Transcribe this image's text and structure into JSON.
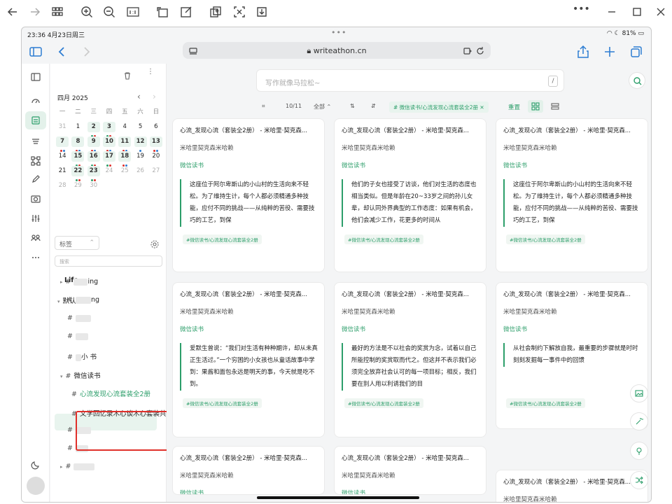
{
  "status": {
    "time": "23:36 4月23日周三",
    "dots": "•••",
    "battery": "81%"
  },
  "browser": {
    "url": "writeathon.cn"
  },
  "calendar": {
    "month": "四月 2025",
    "weekdays": [
      "一",
      "二",
      "三",
      "四",
      "五",
      "六",
      "日"
    ],
    "weeks": [
      [
        "31",
        "1",
        "2",
        "3",
        "4",
        "5",
        "6"
      ],
      [
        "7",
        "8",
        "9",
        "10",
        "11",
        "12",
        "13"
      ],
      [
        "14",
        "15",
        "16",
        "17",
        "18",
        "19",
        "20"
      ],
      [
        "21",
        "22",
        "23",
        "24",
        "25",
        "26",
        "27"
      ],
      [
        "28",
        "29",
        "30",
        "",
        "",
        "",
        ""
      ]
    ]
  },
  "sidebar": {
    "tag_select": "标签",
    "search_placeholder": "搜索",
    "life": "Life",
    "default_category": "默认分类",
    "tree": [
      {
        "label": "#",
        "text": "ing",
        "prefix": "▸"
      },
      {
        "label": "#",
        "text": "ng",
        "prefix": ""
      },
      {
        "label": "#",
        "text": "",
        "prefix": ""
      },
      {
        "label": "#",
        "text": "",
        "prefix": ""
      },
      {
        "label": "#",
        "text": "小    书",
        "prefix": ""
      },
      {
        "label": "#",
        "text": "微信读书",
        "prefix": "▾"
      },
      {
        "label": "#",
        "text": "心流发现心流套装全2册",
        "prefix": ""
      },
      {
        "label": "#",
        "text": "文学回忆录木心谈木心套装共",
        "prefix": ""
      },
      {
        "label": "#",
        "text": "",
        "prefix": ""
      },
      {
        "label": "#",
        "text": "",
        "prefix": ""
      },
      {
        "label": "#",
        "text": "",
        "prefix": "▸"
      },
      {
        "label": "#",
        "text": "",
        "prefix": ""
      }
    ]
  },
  "editor": {
    "placeholder": "写作就像马拉松~",
    "slash": "/"
  },
  "filter": {
    "count": "10/11",
    "all": "全部",
    "chip": "# 微信读书/心流发现心流套装全2册",
    "reset": "重置"
  },
  "cards": [
    {
      "title": "心流_发现心流（套装全2册） - 米哈里·契克森...",
      "author": "米哈里契克森米哈赖",
      "source": "微信读书",
      "quote": "这座位于阿尔卑斯山的小山村的生活向来不轻松。为了维持生计，每个人都必须精通多种技能，应付不同的挑战——从纯粹的苦役、需要技巧的工艺，到保",
      "tag": "#微信读书/心流发现心流套装全2册"
    },
    {
      "title": "心流_发现心流（套装全2册） - 米哈里·契克森...",
      "author": "米哈里契克森米哈赖",
      "source": "微信读书",
      "quote": "他们的子女也接受了访谈，他们对生活的态度也相当类似。但是年龄在20~33岁之间的孙儿女辈，却认同外界典型的工作态度：如果有机会，他们会减少工作，花更多的时间从",
      "tag": "#微信读书/心流发现心流套装全2册"
    },
    {
      "title": "心流_发现心流（套装全2册） - 米哈里·契克森...",
      "author": "米哈里契克森米哈赖",
      "source": "微信读书",
      "quote": "这座位于阿尔卑斯山的小山村的生活向来不轻松。为了维持生计，每个人都必须精通多种技能，应付不同的挑战——从纯粹的苦役、需要技巧的工艺，到保",
      "tag": "#微信读书/心流发现心流套装全2册"
    },
    {
      "title": "心流_发现心流（套装全2册） - 米哈里·契克森...",
      "author": "米哈里契克森米哈赖",
      "source": "微信读书",
      "quote": "爱默生曾说：“我们对生活有种种期许，却从未真正生活过。”一个穷困的小女孩也从童话故事中学到：果酱和面包永远是明天的事，今天就是吃不到。",
      "tag": "#微信读书/心流发现心流套装全2册"
    },
    {
      "title": "心流_发现心流（套装全2册） - 米哈里·契克森...",
      "author": "米哈里契克森米哈赖",
      "source": "微信读书",
      "quote": "最好的方法是不以社会的奖赏为念，试着以自己所能控制的奖赏取而代之。但这并不表示我们必须完全放弃社会认可的每一项目标；相反，我们要在别人用以利诱我们的目",
      "tag": "#微信读书/心流发现心流套装全2册"
    },
    {
      "title": "心流_发现心流（套装全2册） - 米哈里·契克森...",
      "author": "米哈里契克森米哈赖",
      "source": "微信读书",
      "quote": "从社会制约下解放自我，最重要的步骤就是时时刻刻发掘每一事件中的回馈",
      "tag": "#微信读书/心流发现心流套装全2册"
    },
    {
      "title": "心流_发现心流（套装全2册） - 米哈里·契克森...",
      "author": "米哈里契克森米哈赖",
      "source": "微信读书",
      "quote": "",
      "tag": ""
    },
    {
      "title": "心流_发现心流（套装全2册） - 米哈里·契克森...",
      "author": "米哈里契克森米哈赖",
      "source": "微信读书",
      "quote": "",
      "tag": ""
    },
    {
      "title": "心流_发现心流（套装全2册） - 米哈里·契克森...",
      "author": "米哈里契克森米哈赖",
      "source": "微信读书",
      "quote": "",
      "tag": ""
    }
  ],
  "colors": {
    "accent": "#2c9e6a",
    "accent_bg": "#e8f4ee",
    "highlight_box": "#e0302a"
  }
}
